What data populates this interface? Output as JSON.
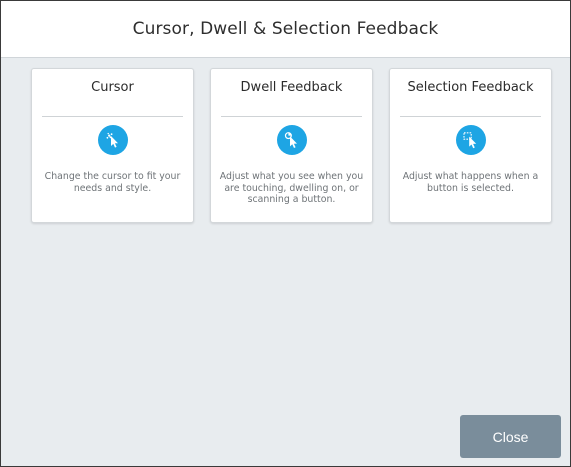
{
  "dialog": {
    "title": "Cursor, Dwell & Selection Feedback"
  },
  "cards": [
    {
      "title": "Cursor",
      "icon": "cursor-sparkle-icon",
      "description": "Change the cursor to fit your needs and style."
    },
    {
      "title": "Dwell Feedback",
      "icon": "dwell-cursor-icon",
      "description": "Adjust what you see when you are touching, dwelling on, or scanning a button."
    },
    {
      "title": "Selection Feedback",
      "icon": "selection-cursor-icon",
      "description": "Adjust what happens when a button is selected."
    }
  ],
  "footer": {
    "close_label": "Close"
  },
  "colors": {
    "accent": "#1ea5e4",
    "close_button": "#7a8d9b",
    "panel_background": "#e8ecef"
  }
}
